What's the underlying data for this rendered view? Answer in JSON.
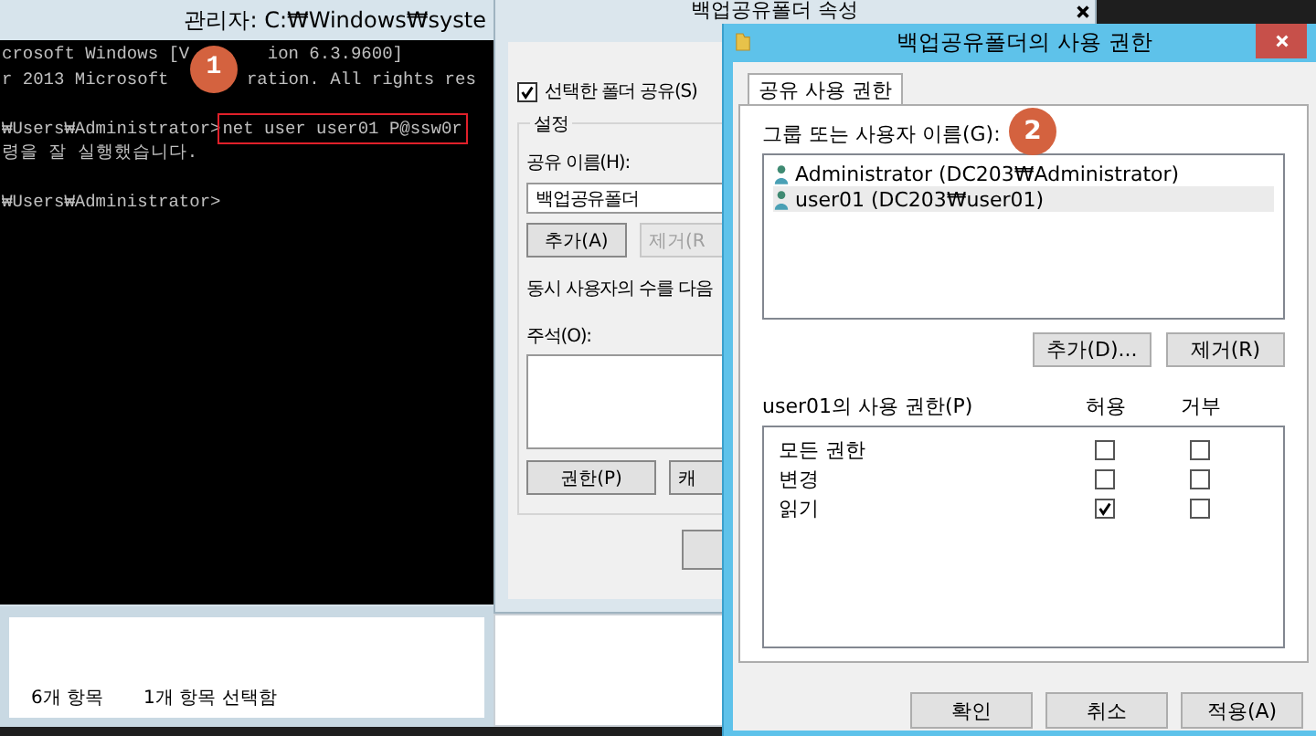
{
  "console_window": {
    "title": "관리자: C:₩Windows₩syste",
    "badge": "1",
    "blocks": [
      [
        {
          "left": "crosoft Windows [V",
          "right": "ion 6.3.9600]"
        },
        {
          "left": "r 2013 Microsoft",
          "right": "ration. All rights res"
        }
      ],
      [
        {
          "left": "₩Users₩Administrator>",
          "command": "net user user01 P@ssw0r"
        },
        {
          "left": "령을 잘 실행했습니다."
        }
      ],
      [
        {
          "left": "₩Users₩Administrator>"
        }
      ]
    ]
  },
  "explorer_status": [
    "6개 항목",
    "1개 항목 선택함"
  ],
  "properties_window": {
    "title": "백업공유폴더 속성",
    "share_checkbox": {
      "label": "선택한 폴더 공유(S)",
      "checked": true
    },
    "group": "설정",
    "share_name_label": "공유 이름(H):",
    "share_name": "백업공유폴더",
    "buttons": [
      {
        "label": "추가(A)",
        "disabled": false
      },
      {
        "label": "제거(R",
        "disabled": true
      }
    ],
    "limit_text": "동시 사용자의 수를 다음",
    "comment_label": "주석(O):",
    "bottom_buttons": [
      {
        "label": "권한(P)"
      },
      {
        "label": "캐"
      }
    ]
  },
  "permission_dialog": {
    "title": "백업공유폴더의 사용 권한",
    "badge": "2",
    "tab": {
      "label": "공유 사용 권한",
      "selected": true
    },
    "users_label": "그룹 또는 사용자 이름(G):",
    "users": [
      {
        "name": "Administrator (DC203₩Administrator)",
        "selected": false
      },
      {
        "name": "user01 (DC203₩user01)",
        "selected": true
      }
    ],
    "user_buttons": [
      "추가(D)...",
      "제거(R)"
    ],
    "permissions_label": "user01의 사용 권한(P)",
    "columns": [
      "허용",
      "거부"
    ],
    "permissions": [
      {
        "name": "모든 권한",
        "allow": false,
        "deny": false
      },
      {
        "name": "변경",
        "allow": false,
        "deny": false
      },
      {
        "name": "읽기",
        "allow": true,
        "deny": false
      }
    ],
    "footer_buttons": [
      "확인",
      "취소",
      "적용(A)"
    ]
  }
}
